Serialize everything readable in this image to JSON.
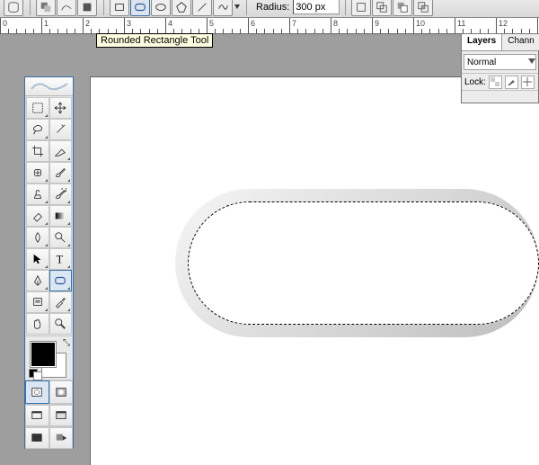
{
  "options": {
    "radius_label": "Radius:",
    "radius_value": "300 px",
    "tooltip": "Rounded Rectangle Tool"
  },
  "ruler": {
    "start": 0,
    "step": 1,
    "count": 13
  },
  "layers_panel": {
    "tabs": [
      "Layers",
      "Chann"
    ],
    "active_tab": 0,
    "blend_mode": "Normal",
    "lock_label": "Lock:"
  },
  "swatches": {
    "foreground": "#000000",
    "background": "#ffffff"
  }
}
